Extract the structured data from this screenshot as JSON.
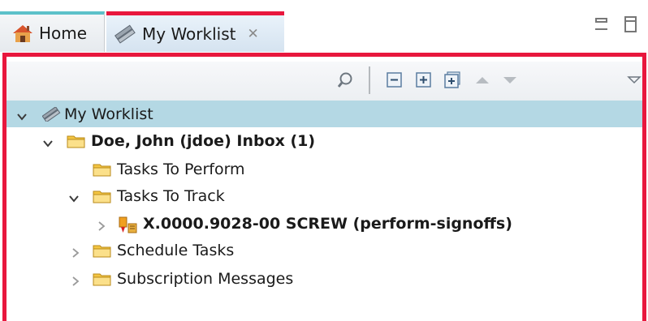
{
  "tabs": [
    {
      "label": "Home",
      "icon": "home-icon"
    },
    {
      "label": "My Worklist",
      "icon": "worklist-icon",
      "active": true
    }
  ],
  "toolbar": {
    "buttons": [
      "search-icon",
      "collapse-all-icon",
      "expand-icon",
      "expand-all-icon",
      "move-up-icon",
      "move-down-icon",
      "view-menu-icon"
    ]
  },
  "tree": {
    "root": "My Worklist",
    "inbox": "Doe, John (jdoe) Inbox (1)",
    "tasks_to_perform": "Tasks To Perform",
    "tasks_to_track": "Tasks To Track",
    "task_item": "X.0000.9028-00 SCREW (perform-signoffs)",
    "schedule_tasks": "Schedule Tasks",
    "subscription_messages": "Subscription Messages"
  },
  "colors": {
    "active_border": "#e8173d",
    "home_tab_accent": "#5cc1c9",
    "selection": "#b4d8e4",
    "folder": "#f4c542"
  }
}
